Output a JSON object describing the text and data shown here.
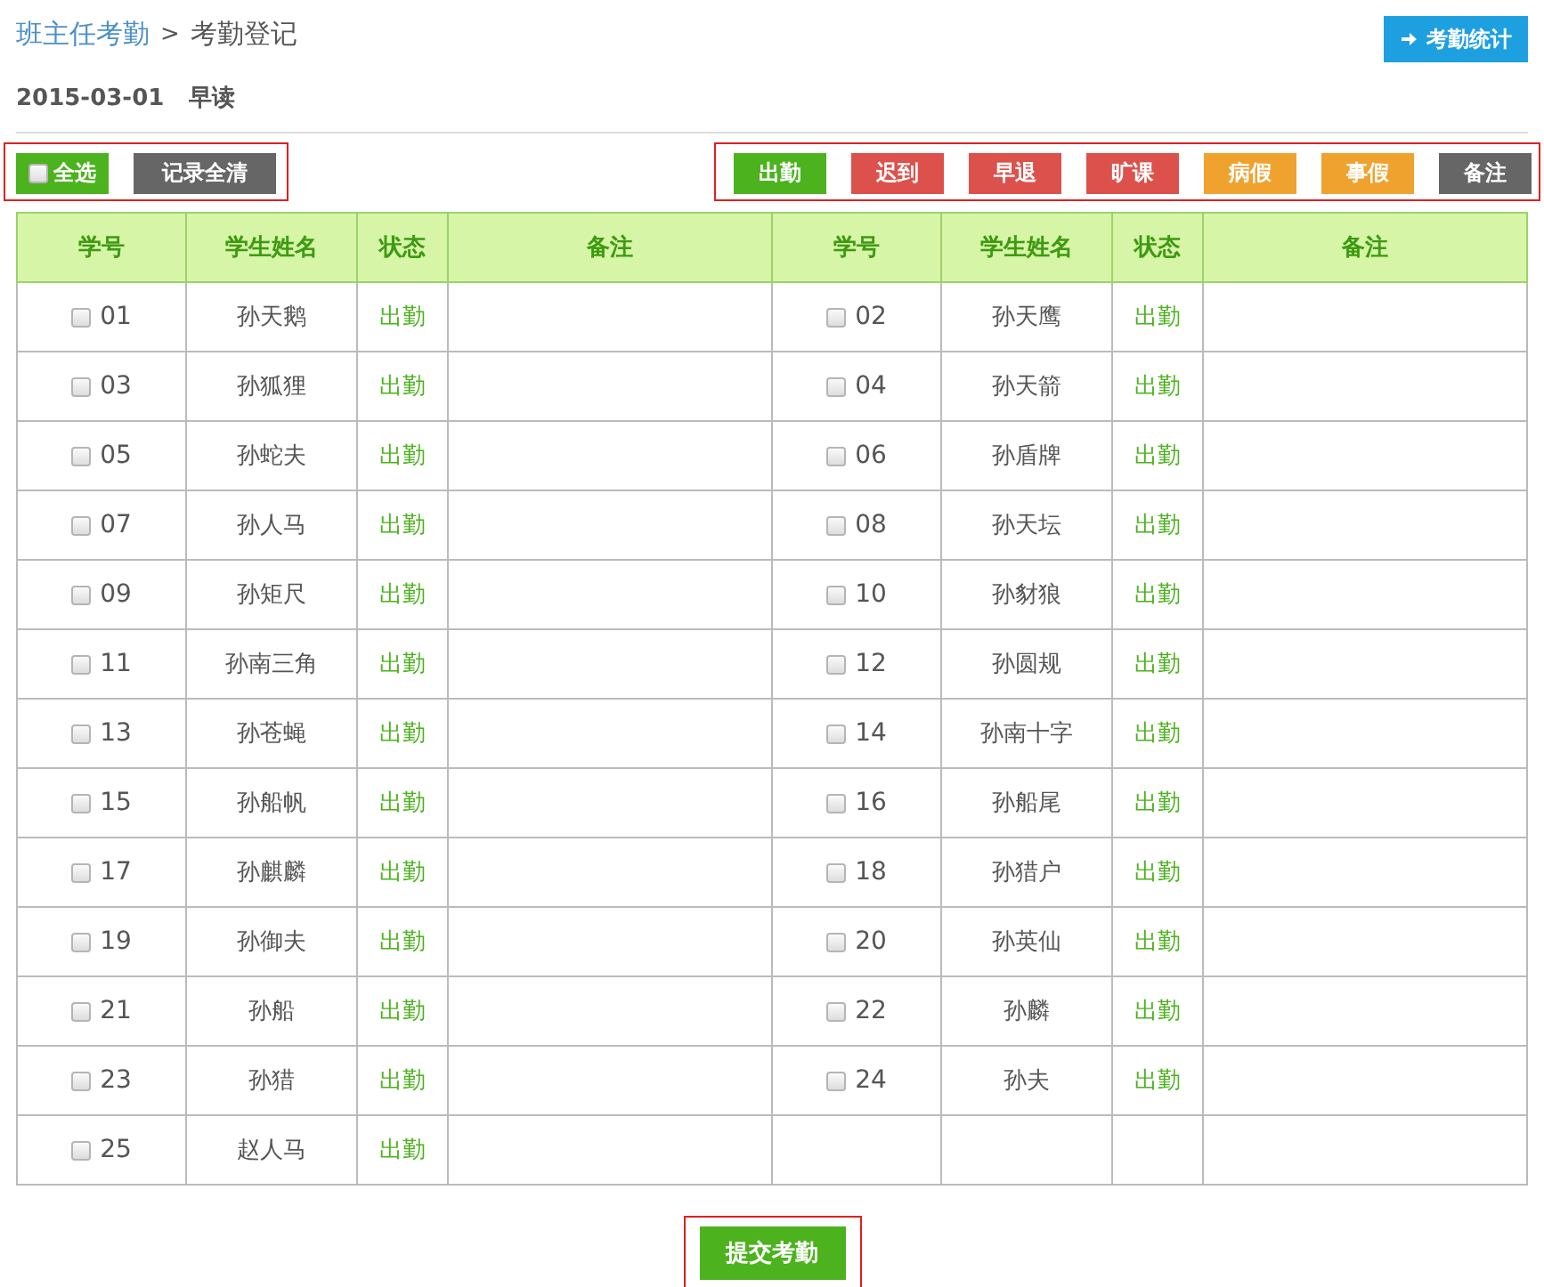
{
  "breadcrumb": {
    "parent": "班主任考勤",
    "separator": ">",
    "current": "考勤登记"
  },
  "stats_button": {
    "label": "考勤统计"
  },
  "session": {
    "date": "2015-03-01",
    "period": "早读"
  },
  "select_all": {
    "label": "全选",
    "checked": false
  },
  "clear_button": {
    "label": "记录全清"
  },
  "status_buttons": [
    {
      "label": "出勤",
      "color": "#4cb21e"
    },
    {
      "label": "迟到",
      "color": "#dd514c"
    },
    {
      "label": "早退",
      "color": "#dd514c"
    },
    {
      "label": "旷课",
      "color": "#dd514c"
    },
    {
      "label": "病假",
      "color": "#f0a22e"
    },
    {
      "label": "事假",
      "color": "#f0a22e"
    },
    {
      "label": "备注",
      "color": "#666666"
    }
  ],
  "table": {
    "columns": [
      "学号",
      "学生姓名",
      "状态",
      "备注",
      "学号",
      "学生姓名",
      "状态",
      "备注"
    ],
    "rows": [
      {
        "left": {
          "number": "01",
          "name": "孙天鹅",
          "status": "出勤",
          "checked": false
        },
        "right": {
          "number": "02",
          "name": "孙天鹰",
          "status": "出勤",
          "checked": false
        }
      },
      {
        "left": {
          "number": "03",
          "name": "孙狐狸",
          "status": "出勤",
          "checked": false
        },
        "right": {
          "number": "04",
          "name": "孙天箭",
          "status": "出勤",
          "checked": false
        }
      },
      {
        "left": {
          "number": "05",
          "name": "孙蛇夫",
          "status": "出勤",
          "checked": false
        },
        "right": {
          "number": "06",
          "name": "孙盾牌",
          "status": "出勤",
          "checked": false
        }
      },
      {
        "left": {
          "number": "07",
          "name": "孙人马",
          "status": "出勤",
          "checked": false
        },
        "right": {
          "number": "08",
          "name": "孙天坛",
          "status": "出勤",
          "checked": false
        }
      },
      {
        "left": {
          "number": "09",
          "name": "孙矩尺",
          "status": "出勤",
          "checked": false
        },
        "right": {
          "number": "10",
          "name": "孙豺狼",
          "status": "出勤",
          "checked": false
        }
      },
      {
        "left": {
          "number": "11",
          "name": "孙南三角",
          "status": "出勤",
          "checked": false
        },
        "right": {
          "number": "12",
          "name": "孙圆规",
          "status": "出勤",
          "checked": false
        }
      },
      {
        "left": {
          "number": "13",
          "name": "孙苍蝇",
          "status": "出勤",
          "checked": false
        },
        "right": {
          "number": "14",
          "name": "孙南十字",
          "status": "出勤",
          "checked": false
        }
      },
      {
        "left": {
          "number": "15",
          "name": "孙船帆",
          "status": "出勤",
          "checked": false
        },
        "right": {
          "number": "16",
          "name": "孙船尾",
          "status": "出勤",
          "checked": false
        }
      },
      {
        "left": {
          "number": "17",
          "name": "孙麒麟",
          "status": "出勤",
          "checked": false
        },
        "right": {
          "number": "18",
          "name": "孙猎户",
          "status": "出勤",
          "checked": false
        }
      },
      {
        "left": {
          "number": "19",
          "name": "孙御夫",
          "status": "出勤",
          "checked": false
        },
        "right": {
          "number": "20",
          "name": "孙英仙",
          "status": "出勤",
          "checked": false
        }
      },
      {
        "left": {
          "number": "21",
          "name": "孙船",
          "status": "出勤",
          "checked": false
        },
        "right": {
          "number": "22",
          "name": "孙麟",
          "status": "出勤",
          "checked": false
        }
      },
      {
        "left": {
          "number": "23",
          "name": "孙猎",
          "status": "出勤",
          "checked": false
        },
        "right": {
          "number": "24",
          "name": "孙夫",
          "status": "出勤",
          "checked": false
        }
      },
      {
        "left": {
          "number": "25",
          "name": "赵人马",
          "status": "出勤",
          "checked": false
        }
      }
    ]
  },
  "submit_button": {
    "label": "提交考勤"
  }
}
